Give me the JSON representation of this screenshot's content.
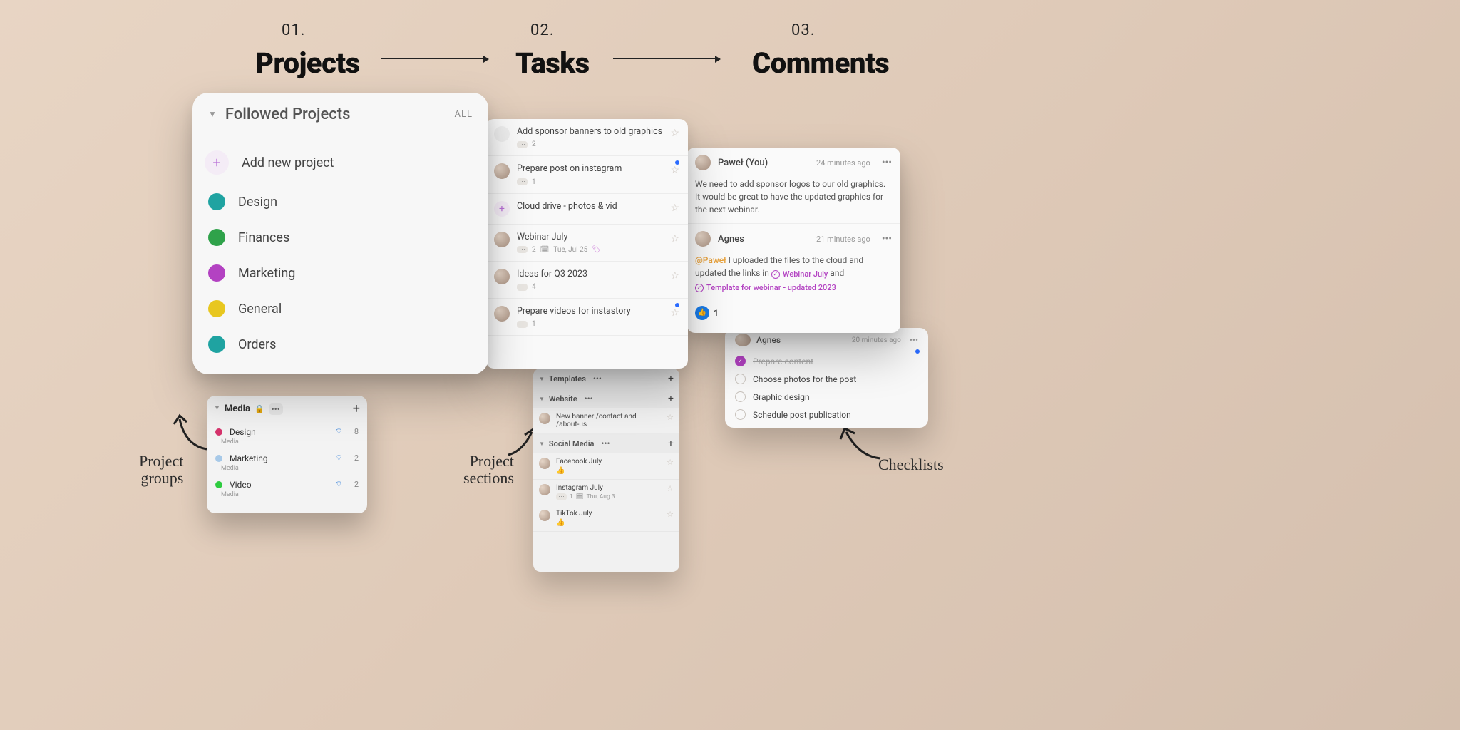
{
  "headings": [
    {
      "num": "01.",
      "title": "Projects"
    },
    {
      "num": "02.",
      "title": "Tasks"
    },
    {
      "num": "03.",
      "title": "Comments"
    }
  ],
  "projects_panel": {
    "header": "Followed Projects",
    "allLabel": "ALL",
    "addLabel": "Add new project",
    "items": [
      {
        "label": "Design",
        "color": "#1fa3a1"
      },
      {
        "label": "Finances",
        "color": "#2fa24a"
      },
      {
        "label": "Marketing",
        "color": "#b342c2"
      },
      {
        "label": "General",
        "color": "#e8c71f"
      },
      {
        "label": "Orders",
        "color": "#1fa3a1"
      }
    ]
  },
  "media_panel": {
    "title": "Media",
    "rows": [
      {
        "name": "Design",
        "sub": "Media",
        "color": "#d6336c",
        "count": "8"
      },
      {
        "name": "Marketing",
        "sub": "Media",
        "color": "#a7c9e8",
        "count": "2"
      },
      {
        "name": "Video",
        "sub": "Media",
        "color": "#2ecc40",
        "count": "2"
      }
    ]
  },
  "tasks_panel": {
    "items": [
      {
        "title": "Add sponsor banners to old graphics",
        "count": "2",
        "star": true,
        "blue": false,
        "avatar": false
      },
      {
        "title": "Prepare post on instagram",
        "count": "1",
        "star": true,
        "blue": true,
        "avatar": true
      },
      {
        "title": "Cloud drive - photos & vid",
        "count": "",
        "star": true,
        "blue": false,
        "avatar": false,
        "plus": true
      },
      {
        "title": "Webinar July",
        "count": "2",
        "date": "Tue, Jul 25",
        "tag": true,
        "star": true,
        "blue": false,
        "avatar": true
      },
      {
        "title": "Ideas for Q3 2023",
        "count": "4",
        "star": true,
        "blue": false,
        "avatar": true
      },
      {
        "title": "Prepare videos for instastory",
        "count": "1",
        "star": false,
        "blue": true,
        "avatar": true
      }
    ]
  },
  "sections_panel": {
    "sections": [
      {
        "name": "Templates",
        "rows": []
      },
      {
        "name": "Website",
        "rows": [
          {
            "title": "New banner /contact and /about-us"
          }
        ]
      },
      {
        "name": "Social Media",
        "rows": [
          {
            "title": "Facebook July",
            "thumb": true
          },
          {
            "title": "Instagram July",
            "count": "1",
            "date": "Thu, Aug 3"
          },
          {
            "title": "TikTok July",
            "thumb": true
          }
        ]
      }
    ]
  },
  "comments_panel": {
    "c1": {
      "name": "Paweł (You)",
      "time": "24 minutes ago",
      "text": "We need to add sponsor logos to our old graphics. It would be great to have the updated graphics for the next webinar."
    },
    "c2": {
      "name": "Agnes",
      "time": "21 minutes ago",
      "mention": "@Paweł",
      "text_before": "I uploaded the files to the cloud and updated the links in",
      "link1": "Webinar July",
      "middle": "and",
      "link2": "Template for webinar - updated 2023",
      "like_count": "1"
    }
  },
  "checklist_panel": {
    "author": "Agnes",
    "time": "20 minutes ago",
    "items": [
      {
        "label": "Prepare content",
        "done": true
      },
      {
        "label": "Choose photos for the post",
        "done": false
      },
      {
        "label": "Graphic design",
        "done": false
      },
      {
        "label": "Schedule post publication",
        "done": false
      }
    ]
  },
  "annotations": {
    "project_groups": "Project\ngroups",
    "project_sections": "Project\nsections",
    "checklists": "Checklists"
  }
}
